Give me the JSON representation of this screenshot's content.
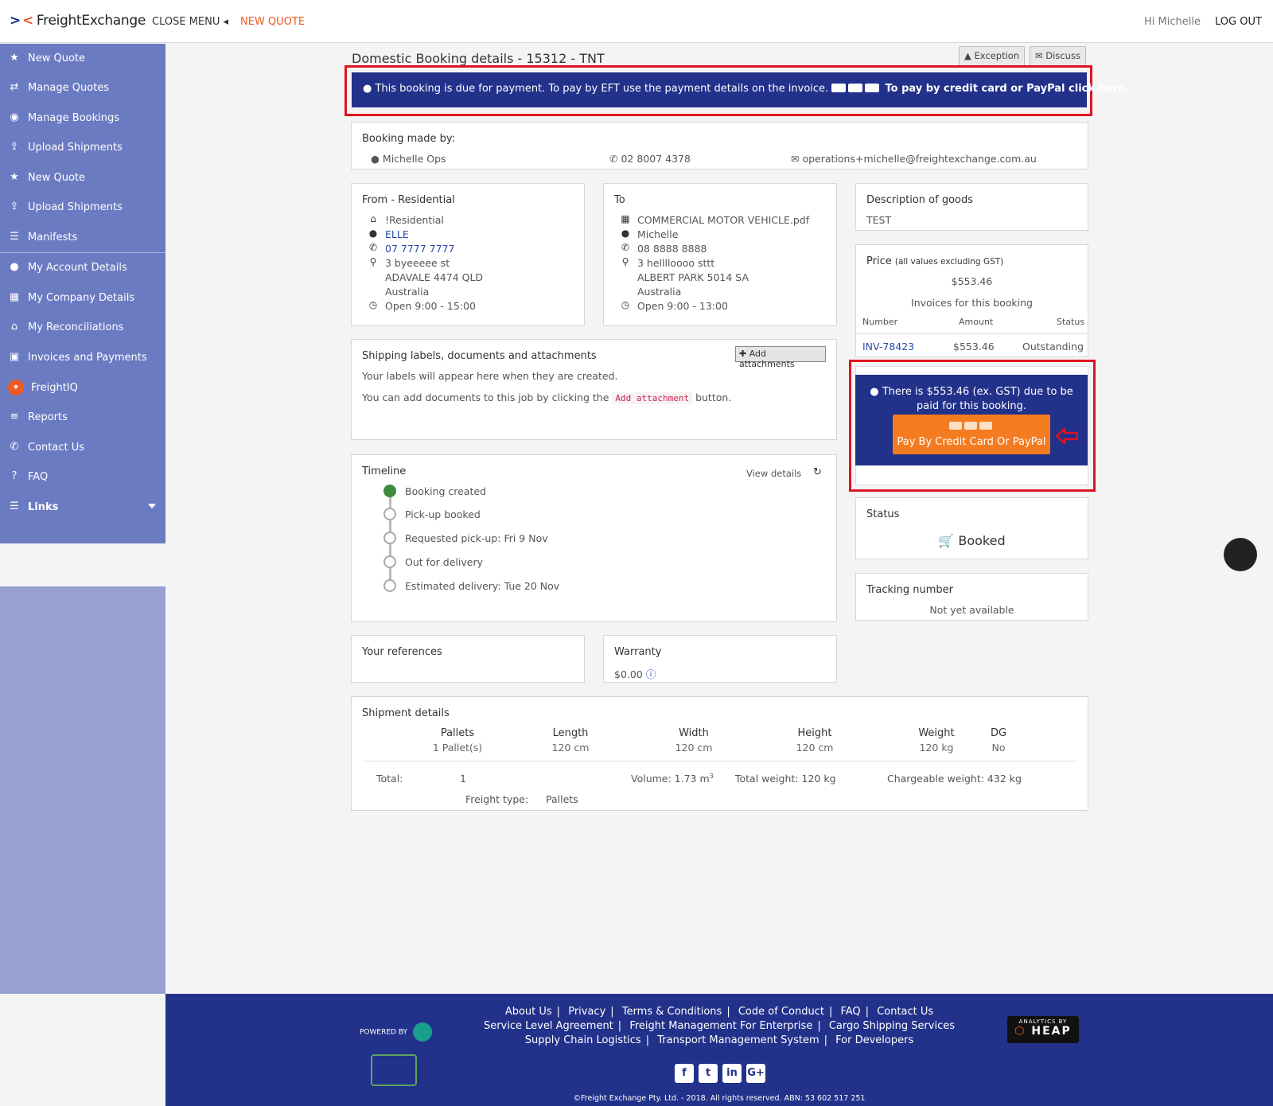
{
  "topbar": {
    "logo": "FreightExchange",
    "close_menu": "CLOSE MENU",
    "new_quote": "NEW QUOTE",
    "greeting": "Hi Michelle",
    "logout": "LOG OUT"
  },
  "sidebar": {
    "items": [
      {
        "label": "New Quote",
        "icon": "star-icon"
      },
      {
        "label": "Manage Quotes",
        "icon": "exchange-icon"
      },
      {
        "label": "Manage Bookings",
        "icon": "dashboard-icon"
      },
      {
        "label": "Upload Shipments",
        "icon": "upload-icon"
      },
      {
        "label": "New Quote",
        "icon": "star-icon"
      },
      {
        "label": "Upload Shipments",
        "icon": "upload-icon"
      },
      {
        "label": "Manifests",
        "icon": "list-icon"
      },
      {
        "label": "My Account Details",
        "icon": "user-icon"
      },
      {
        "label": "My Company Details",
        "icon": "building-icon"
      },
      {
        "label": "My Reconciliations",
        "icon": "bank-icon"
      },
      {
        "label": "Invoices and Payments",
        "icon": "money-icon"
      },
      {
        "label": "FreightIQ",
        "icon": "lightbulb-icon"
      },
      {
        "label": "Reports",
        "icon": "database-icon"
      },
      {
        "label": "Contact Us",
        "icon": "phone-icon"
      },
      {
        "label": "FAQ",
        "icon": "question-icon"
      },
      {
        "label": "Links",
        "icon": "bars-icon"
      }
    ]
  },
  "page": {
    "title": "Domestic Booking details - 15312 - TNT",
    "exception_button": "Exception",
    "discuss_button": "Discuss",
    "payment_banner_text": "This booking is due for payment. To pay by EFT use the payment details on the invoice.",
    "payment_banner_link": "To pay by credit card or PayPal click here."
  },
  "booking_made_by": {
    "heading": "Booking made by:",
    "name": "Michelle Ops",
    "phone": "02 8007 4378",
    "email": "operations+michelle@freightexchange.com.au"
  },
  "from": {
    "heading": "From - Residential",
    "company": "!Residential",
    "contact": "ELLE",
    "phone": "07 7777 7777",
    "street": "3 byeeeee st",
    "city": "ADAVALE 4474 QLD",
    "country": "Australia",
    "hours": "Open 9:00 - 15:00"
  },
  "to": {
    "heading": "To",
    "company": "COMMERCIAL MOTOR VEHICLE.pdf",
    "contact": "Michelle",
    "phone": "08 8888 8888",
    "street": "3 helllloooo sttt",
    "city": "ALBERT PARK 5014 SA",
    "country": "Australia",
    "hours": "Open 9:00 - 13:00"
  },
  "goods": {
    "heading": "Description of goods",
    "value": "TEST"
  },
  "price": {
    "heading": "Price",
    "heading_note": "(all values excluding GST)",
    "amount": "$553.46",
    "invoices_heading": "Invoices for this booking",
    "columns": [
      "Number",
      "Amount",
      "Status"
    ],
    "rows": [
      {
        "number": "INV-78423",
        "amount": "$553.46",
        "status": "Outstanding"
      }
    ]
  },
  "due": {
    "text": "There is $553.46 (ex. GST) due to be paid for this booking.",
    "button": "Pay By Credit Card Or PayPal"
  },
  "attachments": {
    "heading": "Shipping labels, documents and attachments",
    "button": "Add attachments",
    "line1": "Your labels will appear here when they are created.",
    "line2_pre": "You can add documents to this job by clicking the",
    "line2_code": "Add attachment",
    "line2_post": "button."
  },
  "timeline": {
    "heading": "Timeline",
    "view_details": "View details",
    "steps": [
      {
        "label": "Booking created",
        "done": true
      },
      {
        "label": "Pick-up booked",
        "done": false
      },
      {
        "label": "Requested pick-up: Fri 9 Nov",
        "done": false
      },
      {
        "label": "Out for delivery",
        "done": false
      },
      {
        "label": "Estimated delivery: Tue 20 Nov",
        "done": false
      }
    ]
  },
  "status": {
    "heading": "Status",
    "value": "Booked"
  },
  "tracking": {
    "heading": "Tracking number",
    "value": "Not yet available"
  },
  "references": {
    "heading": "Your references"
  },
  "warranty": {
    "heading": "Warranty",
    "value": "$0.00"
  },
  "shipment": {
    "heading": "Shipment details",
    "columns": [
      "Pallets",
      "Length",
      "Width",
      "Height",
      "Weight",
      "DG"
    ],
    "row": [
      "1 Pallet(s)",
      "120 cm",
      "120 cm",
      "120 cm",
      "120 kg",
      "No"
    ],
    "total_label": "Total:",
    "total_value": "1",
    "volume": "Volume: 1.73 m",
    "volume_unit_sup": "3",
    "total_weight": "Total weight: 120 kg",
    "chargeable_weight": "Chargeable weight: 432 kg",
    "freight_type_label": "Freight type:",
    "freight_type_value": "Pallets"
  },
  "footer": {
    "powered_by": "POWERED BY",
    "links_row1": [
      "About Us",
      "Privacy",
      "Terms & Conditions",
      "Code of Conduct",
      "FAQ",
      "Contact Us"
    ],
    "links_row2": [
      "Service Level Agreement",
      "Freight Management For Enterprise",
      "Cargo Shipping Services"
    ],
    "links_row3": [
      "Supply Chain Logistics",
      "Transport Management System",
      "For Developers"
    ],
    "copyright": "©Freight Exchange Pty. Ltd. - 2018. All rights reserved.  ABN: 53 602 517 251",
    "heap_top": "ANALYTICS BY",
    "heap_brand": "HEAP"
  }
}
